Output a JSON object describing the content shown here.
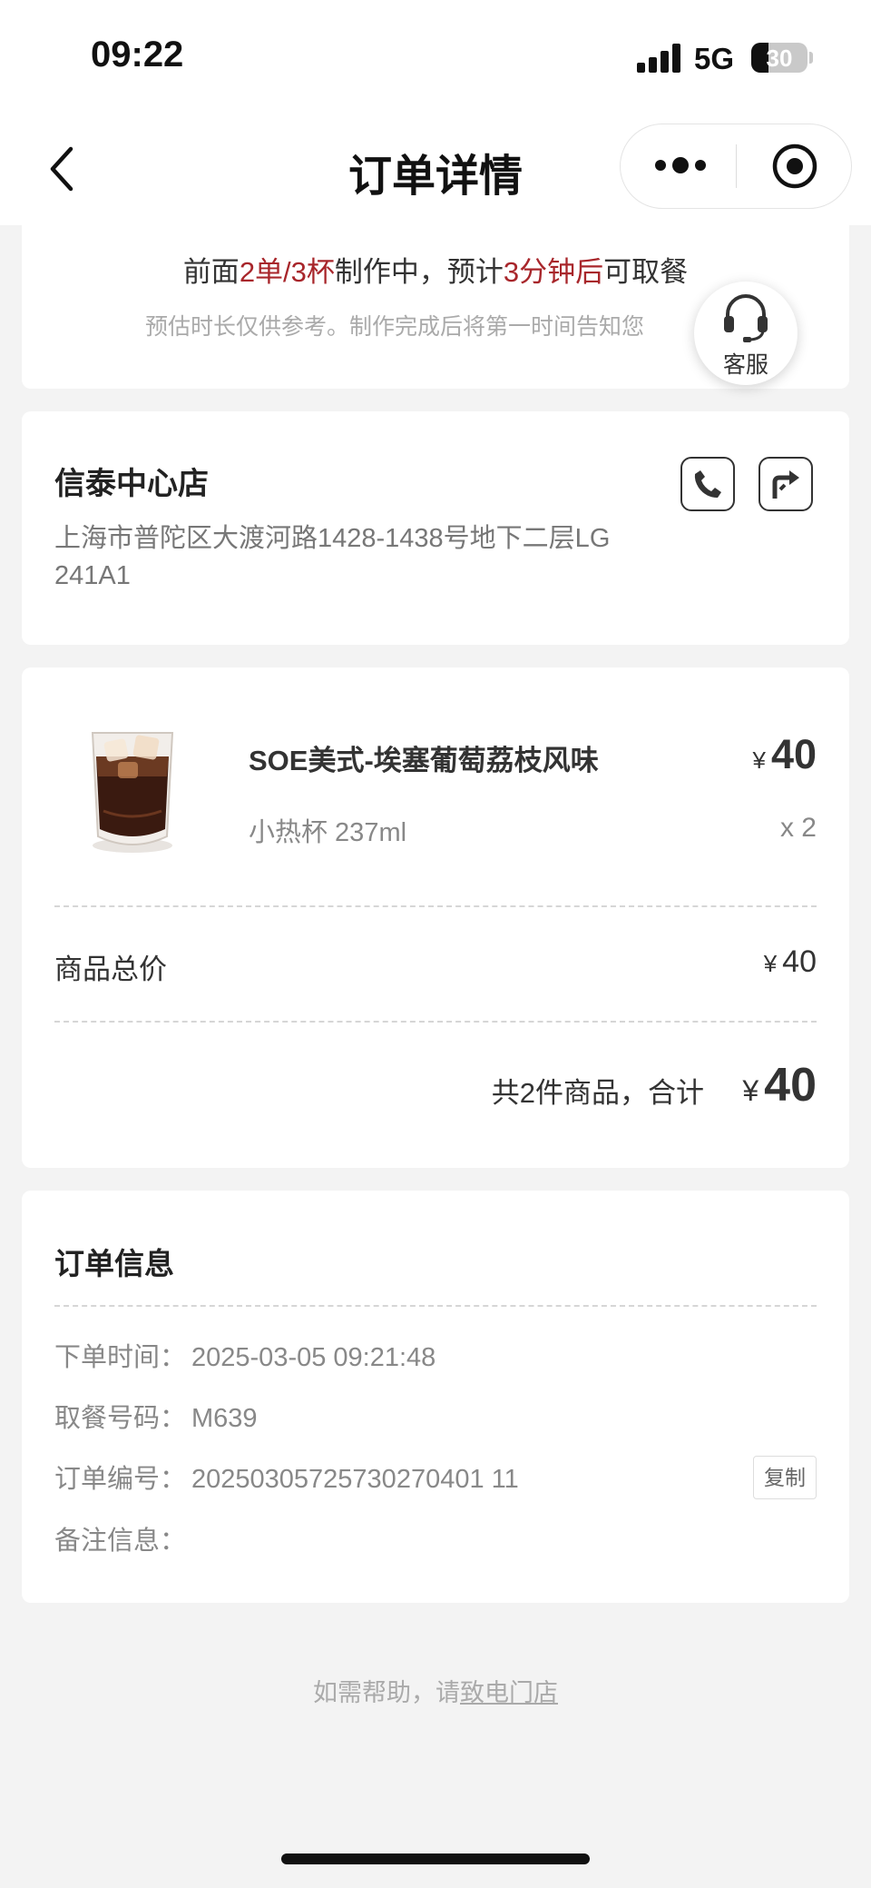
{
  "status_bar": {
    "time": "09:22",
    "network": "5G",
    "battery": "30",
    "battery_level": 0.3
  },
  "nav": {
    "title": "订单详情"
  },
  "queue": {
    "part1": "前面",
    "hl1": "2单/3杯",
    "part2": "制作中，预计",
    "hl2": "3分钟后",
    "part3": "可取餐",
    "note": "预估时长仅供参考。制作完成后将第一时间告知您",
    "highlight_color": "#a8262b"
  },
  "customer_service": {
    "label": "客服",
    "icon": "headset-icon"
  },
  "store": {
    "name": "信泰中心店",
    "address": "上海市普陀区大渡河路1428-1438号地下二层LG 241A1",
    "phone_icon": "phone-icon",
    "nav_icon": "directions-icon"
  },
  "product": {
    "name": "SOE美式-埃塞葡萄荔枝风味",
    "currency": "¥",
    "price": "40",
    "spec": "小热杯 237ml",
    "qty": "x 2"
  },
  "summary": {
    "subtotal_label": "商品总价",
    "subtotal_currency": "¥",
    "subtotal_value": "40",
    "total_text": "共2件商品，合计",
    "total_currency": "¥",
    "total_value": "40"
  },
  "order_info": {
    "title": "订单信息",
    "rows": [
      {
        "label": "下单时间：",
        "value": "2025-03-05 09:21:48"
      },
      {
        "label": "取餐号码：",
        "value": "M639"
      },
      {
        "label": "订单编号：",
        "value": "20250305725730270401 11"
      },
      {
        "label": "备注信息：",
        "value": ""
      }
    ],
    "copy_label": "复制"
  },
  "help": {
    "prefix": "如需帮助，请",
    "link": "致电门店"
  }
}
